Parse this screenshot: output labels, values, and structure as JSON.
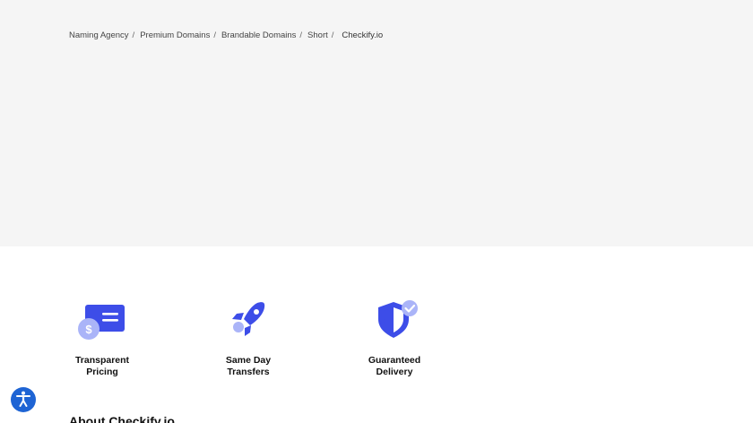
{
  "breadcrumb": {
    "items": [
      {
        "label": "Naming Agency"
      },
      {
        "label": "Premium Domains"
      },
      {
        "label": "Brandable Domains"
      },
      {
        "label": "Short"
      }
    ],
    "separator": "/",
    "current": "Checkify.io"
  },
  "features": [
    {
      "line1": "Transparent",
      "line2": "Pricing",
      "icon": "price-tag-icon"
    },
    {
      "line1": "Same Day",
      "line2": "Transfers",
      "icon": "rocket-icon"
    },
    {
      "line1": "Guaranteed",
      "line2": "Delivery",
      "icon": "shield-check-icon"
    }
  ],
  "about": {
    "heading": "About Checkify.io"
  },
  "accessibility": {
    "icon": "accessibility-icon"
  },
  "colors": {
    "hero_bg": "#f5f5f5",
    "accent": "#3d4de8",
    "accent_light": "#aab4f8",
    "a11y": "#1e64d4"
  }
}
